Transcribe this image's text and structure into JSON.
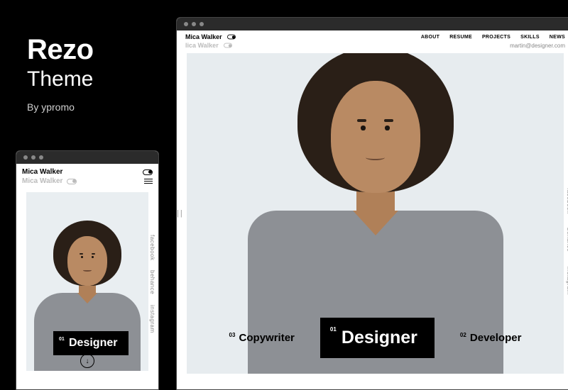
{
  "promo": {
    "name": "Rezo",
    "tagline": "Theme",
    "byline": "By ypromo"
  },
  "site": {
    "owner": "Mica Walker",
    "owner_shadow": "lica Walker",
    "email": "martin@designer.com",
    "nav": {
      "about": "ABOUT",
      "resume": "RESUME",
      "projects": "PROJECTS",
      "skills": "SKILLS",
      "news": "NEWS"
    },
    "social": {
      "facebook": "facebook",
      "behance": "behance",
      "instagram": "instagram"
    },
    "roles": {
      "left": {
        "num": "03",
        "label": "Copywriter"
      },
      "center": {
        "num": "01",
        "label": "Designer"
      },
      "right": {
        "num": "02",
        "label": "Developer"
      }
    },
    "scroll_arrow": "↓"
  },
  "mobile": {
    "owner": "Mica Walker",
    "owner_shadow": "Mica Walker",
    "role": {
      "num": "01",
      "label": "Designer"
    }
  }
}
